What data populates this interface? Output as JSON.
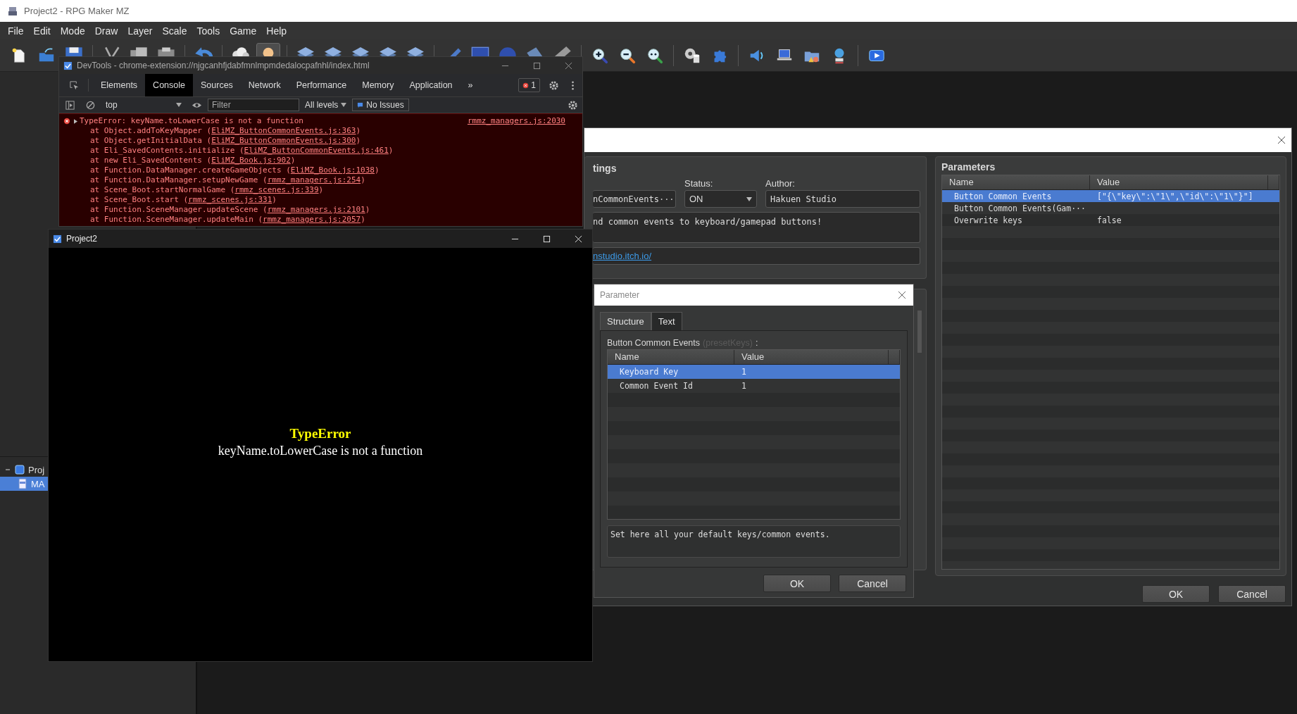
{
  "app": {
    "title": "Project2 - RPG Maker MZ",
    "menu": [
      "File",
      "Edit",
      "Mode",
      "Draw",
      "Layer",
      "Scale",
      "Tools",
      "Game",
      "Help"
    ],
    "toolbar": [
      {
        "items": [
          {
            "kind": "new",
            "selected": false
          },
          {
            "kind": "open",
            "selected": false
          },
          {
            "kind": "save",
            "selected": false
          }
        ]
      },
      {
        "items": [
          {
            "kind": "cut",
            "selected": false
          },
          {
            "kind": "copy",
            "selected": false
          },
          {
            "kind": "paste",
            "selected": false
          }
        ]
      },
      {
        "items": [
          {
            "kind": "undo",
            "selected": false
          }
        ]
      },
      {
        "items": [
          {
            "kind": "map",
            "selected": false
          },
          {
            "kind": "event",
            "selected": true
          }
        ]
      },
      {
        "items": [
          {
            "kind": "layer",
            "selected": false
          },
          {
            "kind": "layer",
            "selected": false
          },
          {
            "kind": "layer",
            "selected": false
          },
          {
            "kind": "layer",
            "selected": false
          },
          {
            "kind": "layer",
            "selected": false
          }
        ]
      },
      {
        "items": [
          {
            "kind": "pencil",
            "selected": false
          },
          {
            "kind": "rect",
            "selected": false
          },
          {
            "kind": "ellipse",
            "selected": false
          },
          {
            "kind": "fill",
            "selected": false
          },
          {
            "kind": "shadow",
            "selected": false
          }
        ]
      },
      {
        "items": [
          {
            "kind": "zoom-in",
            "selected": false
          },
          {
            "kind": "zoom-out",
            "selected": false
          },
          {
            "kind": "zoom-reset",
            "selected": false
          }
        ]
      },
      {
        "items": [
          {
            "kind": "database",
            "selected": false
          },
          {
            "kind": "plugins",
            "selected": false
          }
        ]
      },
      {
        "items": [
          {
            "kind": "sound",
            "selected": false
          },
          {
            "kind": "search",
            "selected": false
          },
          {
            "kind": "resources",
            "selected": false
          },
          {
            "kind": "character",
            "selected": false
          }
        ]
      },
      {
        "items": [
          {
            "kind": "play",
            "selected": false
          }
        ]
      }
    ],
    "tree": [
      {
        "label": "Proj",
        "expanded": true,
        "selected": false,
        "children": [
          {
            "label": "MA",
            "selected": true
          }
        ]
      }
    ]
  },
  "devtools": {
    "title": "DevTools - chrome-extension://njgcanhfjdabfmnlmpmdedalocpafnhl/index.html",
    "tabs": [
      {
        "label": "Elements",
        "selected": false
      },
      {
        "label": "Console",
        "selected": true
      },
      {
        "label": "Sources",
        "selected": false
      },
      {
        "label": "Network",
        "selected": false
      },
      {
        "label": "Performance",
        "selected": false
      },
      {
        "label": "Memory",
        "selected": false
      },
      {
        "label": "Application",
        "selected": false
      }
    ],
    "more": "»",
    "error_count": "1",
    "context": "top",
    "filter": {
      "placeholder": "Filter"
    },
    "levels": "All levels",
    "issues": "No Issues",
    "error": {
      "message": "TypeError: keyName.toLowerCase is not a function",
      "source": "rmmz_managers.js:2030",
      "stack": [
        {
          "before": "at Object.addToKeyMapper (",
          "link": "EliMZ_ButtonCommonEvents.js:363",
          "after": ")"
        },
        {
          "before": "at Object.getInitialData (",
          "link": "EliMZ_ButtonCommonEvents.js:300",
          "after": ")"
        },
        {
          "before": "at Eli_SavedContents.initialize (",
          "link": "EliMZ_ButtonCommonEvents.js:461",
          "after": ")"
        },
        {
          "before": "at new Eli_SavedContents (",
          "link": "EliMZ_Book.js:902",
          "after": ")"
        },
        {
          "before": "at Function.DataManager.createGameObjects (",
          "link": "EliMZ_Book.js:1038",
          "after": ")"
        },
        {
          "before": "at Function.DataManager.setupNewGame (",
          "link": "rmmz_managers.js:254",
          "after": ")"
        },
        {
          "before": "at Scene_Boot.startNormalGame (",
          "link": "rmmz_scenes.js:339",
          "after": ")"
        },
        {
          "before": "at Scene_Boot.start (",
          "link": "rmmz_scenes.js:331",
          "after": ")"
        },
        {
          "before": "at Function.SceneManager.updateScene (",
          "link": "rmmz_managers.js:2101",
          "after": ")"
        },
        {
          "before": "at Function.SceneManager.updateMain (",
          "link": "rmmz_managers.js:2057",
          "after": ")"
        }
      ]
    }
  },
  "game": {
    "title": "Project2",
    "error_title": "TypeError",
    "error_message": "keyName.toLowerCase is not a function"
  },
  "plugin": {
    "settings_title": "tings",
    "name": "nCommonEvents",
    "name_button": "···",
    "status_label": "Status:",
    "status": "ON",
    "author_label": "Author:",
    "author": "Hakuen Studio",
    "description": "nd common events to keyboard/gamepad buttons!",
    "url": "nstudio.itch.io/",
    "params_title": "Parameters",
    "columns": [
      "Name",
      "Value"
    ],
    "rows": [
      {
        "name": "Button Common Events",
        "value": "[\"{\\\"key\\\":\\\"1\\\",\\\"id\\\":\\\"1\\\"}\"]",
        "selected": true
      },
      {
        "name": "Button Common Events(Gam···",
        "value": "",
        "selected": false
      },
      {
        "name": "Overwrite keys",
        "value": "false",
        "selected": false
      }
    ],
    "buttons": [
      "OK",
      "Cancel"
    ]
  },
  "parameter": {
    "title": "Parameter",
    "tabs": [
      {
        "label": "Structure",
        "selected": true
      },
      {
        "label": "Text",
        "selected": false
      }
    ],
    "label": "Button Common Events",
    "key": "(presetKeys)",
    "colon": ":",
    "columns": [
      "Name",
      "Value"
    ],
    "rows": [
      {
        "name": "Keyboard Key",
        "value": "1",
        "selected": true
      },
      {
        "name": "Common Event Id",
        "value": "1",
        "selected": false
      }
    ],
    "description": "Set here all your default keys/common events.",
    "buttons": [
      "OK",
      "Cancel"
    ]
  }
}
